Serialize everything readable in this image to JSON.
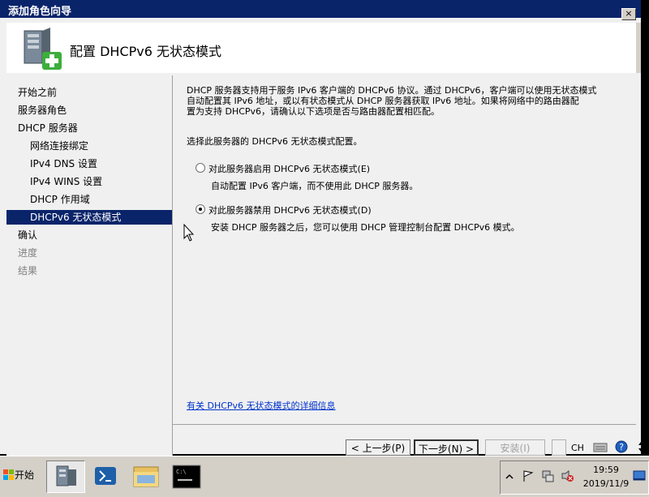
{
  "window": {
    "title": "添加角色向导",
    "close_label": "×"
  },
  "header": {
    "title": "配置 DHCPv6 无状态模式"
  },
  "sidebar": {
    "items": [
      {
        "label": "开始之前",
        "state": "normal"
      },
      {
        "label": "服务器角色",
        "state": "normal"
      },
      {
        "label": "DHCP 服务器",
        "state": "normal"
      },
      {
        "label": "网络连接绑定",
        "state": "sub"
      },
      {
        "label": "IPv4 DNS 设置",
        "state": "sub"
      },
      {
        "label": "IPv4 WINS 设置",
        "state": "sub"
      },
      {
        "label": "DHCP 作用域",
        "state": "sub"
      },
      {
        "label": "DHCPv6 无状态模式",
        "state": "active"
      },
      {
        "label": "确认",
        "state": "normal"
      },
      {
        "label": "进度",
        "state": "disabled"
      },
      {
        "label": "结果",
        "state": "disabled"
      }
    ]
  },
  "content": {
    "intro_line1": "DHCP 服务器支持用于服务 IPv6 客户端的 DHCPv6 协议。通过 DHCPv6，客户端可以使用无状态模式",
    "intro_line2": "自动配置其 IPv6 地址，或以有状态模式从 DHCP 服务器获取 IPv6 地址。如果将网络中的路由器配",
    "intro_line3": "置为支持 DHCPv6，请确认以下选项是否与路由器配置相匹配。",
    "prompt": "选择此服务器的 DHCPv6 无状态模式配置。",
    "option_enable": {
      "label": "对此服务器启用 DHCPv6 无状态模式(E)",
      "desc": "自动配置 IPv6 客户端，而不使用此 DHCP 服务器。",
      "checked": false
    },
    "option_disable": {
      "label": "对此服务器禁用 DHCPv6 无状态模式(D)",
      "desc": "安装 DHCP 服务器之后，您可以使用 DHCP 管理控制台配置 DHCPv6 模式。",
      "checked": true
    },
    "info_link": "有关 DHCPv6 无状态模式的详细信息"
  },
  "buttons": {
    "prev": "< 上一步(P)",
    "next": "下一步(N) >",
    "install": "安装(I)",
    "cancel": ""
  },
  "taskbar": {
    "start_label": "开始",
    "language": "CH",
    "time": "19:59",
    "date": "2019/11/9"
  },
  "colors": {
    "title_bar": "#0a246a",
    "selection": "#0a246a",
    "link": "#0033cc"
  }
}
